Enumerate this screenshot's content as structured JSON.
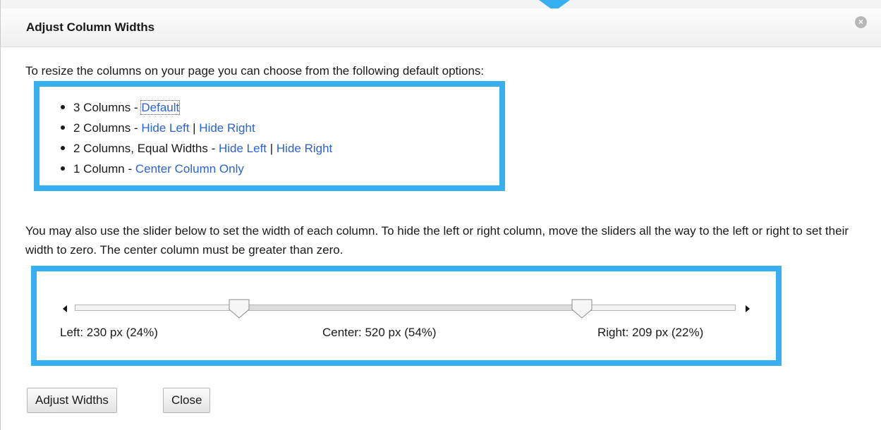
{
  "dialog": {
    "title": "Adjust Column Widths",
    "close_icon": "close-icon"
  },
  "intro": "To resize the columns on your page you can choose from the following default options:",
  "options": [
    {
      "prefix": "3 Columns - ",
      "links": [
        "Default"
      ]
    },
    {
      "prefix": "2 Columns - ",
      "links": [
        "Hide Left",
        "Hide Right"
      ]
    },
    {
      "prefix": "2 Columns, Equal Widths - ",
      "links": [
        "Hide Left",
        "Hide Right"
      ]
    },
    {
      "prefix": "1 Column - ",
      "links": [
        "Center Column Only"
      ]
    }
  ],
  "link_separator": " | ",
  "slider_text": "You may also use the slider below to set the width of each column. To hide the left or right column, move the sliders all the way to the left or right to set their width to zero. The center column must be greater than zero.",
  "slider": {
    "left_label": "Left: 230 px (24%)",
    "center_label": "Center: 520 px (54%)",
    "right_label": "Right: 209 px (22%)",
    "left_fraction": 0.24,
    "center_fraction": 0.54,
    "right_fraction": 0.22
  },
  "buttons": {
    "adjust": "Adjust Widths",
    "close": "Close"
  },
  "colors": {
    "highlight": "#36b0f0",
    "link": "#2a62d8"
  }
}
